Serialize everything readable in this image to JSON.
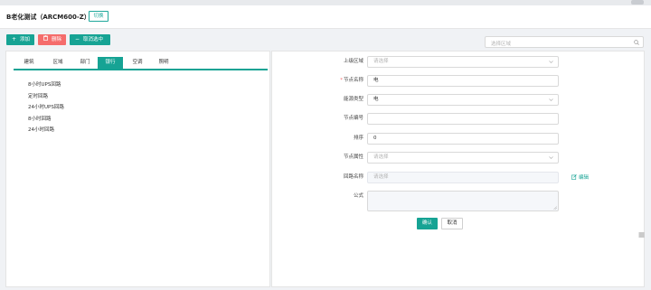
{
  "header": {
    "title": "B老化测试（ARCM600-Z）",
    "switch_label": "切换"
  },
  "toolbar": {
    "add_label": "添加",
    "delete_label": "删除",
    "cancel_select_label": "取消选中"
  },
  "area_select": {
    "placeholder": "选择区域"
  },
  "tabs": [
    {
      "label": "建筑",
      "active": false
    },
    {
      "label": "区域",
      "active": false
    },
    {
      "label": "部门",
      "active": false
    },
    {
      "label": "银行",
      "active": true
    },
    {
      "label": "空调",
      "active": false
    },
    {
      "label": "照明",
      "active": false
    }
  ],
  "tree": [
    "8小时UPS回路",
    "定时回路",
    "24小时UPS回路",
    "8小时回路",
    "24小时回路"
  ],
  "form": {
    "parent_area": {
      "label": "上级区域",
      "placeholder": "请选择"
    },
    "node_name": {
      "label": "节点名称",
      "value": "电"
    },
    "energy_type": {
      "label": "能源类型",
      "value": "电"
    },
    "node_code": {
      "label": "节点编号",
      "value": ""
    },
    "sort": {
      "label": "排序",
      "value": "0"
    },
    "node_attr": {
      "label": "节点属性",
      "placeholder": "请选择"
    },
    "loop_name": {
      "label": "回路名称",
      "placeholder": "请选择"
    },
    "formula": {
      "label": "公式",
      "value": ""
    },
    "edit_label": "编辑",
    "ok_label": "确认",
    "cancel_label": "取消"
  },
  "colors": {
    "accent": "#16a394",
    "danger": "#f56c6c"
  }
}
